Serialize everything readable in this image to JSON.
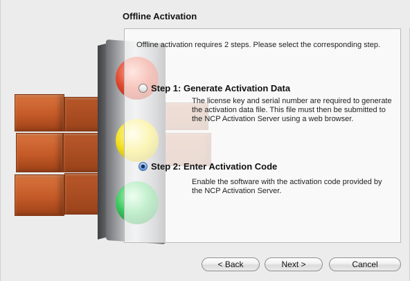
{
  "header": {
    "title": "Offline Activation"
  },
  "panel": {
    "intro": "Offline activation requires 2 steps. Please select the corresponding step.",
    "options": [
      {
        "label": "Step 1: Generate Activation Data",
        "description": "The license key and serial number are required to generate the activation data file. This file must then be submitted to the NCP Activation Server using a web browser.",
        "selected": false
      },
      {
        "label": "Step 2: Enter Activation Code",
        "description": "Enable the software with the activation code provided by the NCP Activation Server.",
        "selected": true
      }
    ]
  },
  "buttons": {
    "back": "< Back",
    "next": "Next >",
    "cancel": "Cancel"
  },
  "icons": {
    "illustration": "traffic-light-brick-wall-illustration"
  }
}
